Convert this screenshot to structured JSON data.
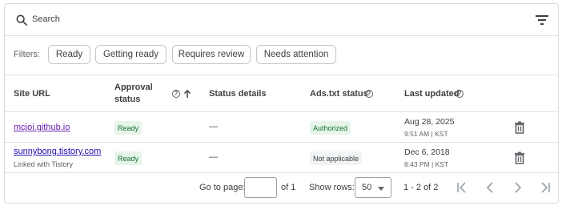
{
  "search": {
    "placeholder": "Search"
  },
  "filters": {
    "label": "Filters:",
    "chips": [
      "Ready",
      "Getting ready",
      "Requires review",
      "Needs attention"
    ]
  },
  "table": {
    "headers": {
      "site_url": "Site URL",
      "approval_line1": "Approval",
      "approval_line2": "status",
      "status_details": "Status details",
      "ads_txt": "Ads.txt status",
      "last_updated": "Last updated"
    },
    "rows": [
      {
        "site": "mcjoi.github.io",
        "site_sub": "",
        "approval": "Ready",
        "status_details": "—",
        "ads_txt": "Authorized",
        "date": "Aug 28, 2025",
        "time": "9:51 AM | KST"
      },
      {
        "site": "sunnybong.tistory.com",
        "site_sub": "Linked with Tistory",
        "approval": "Ready",
        "status_details": "—",
        "ads_txt": "Not applicable",
        "date": "Dec 6, 2018",
        "time": "8:43 PM | KST"
      }
    ]
  },
  "footer": {
    "go_to_page": "Go to page:",
    "page_value": "",
    "of_pages": "of 1",
    "show_rows": "Show rows:",
    "rows_value": "50",
    "range": "1 - 2 of 2"
  },
  "colors": {
    "ready_bg": "#e6f4ea",
    "ready_text": "#137333",
    "link": "#1a0dab",
    "visited_link": "#681da8",
    "border": "#dadce0"
  }
}
